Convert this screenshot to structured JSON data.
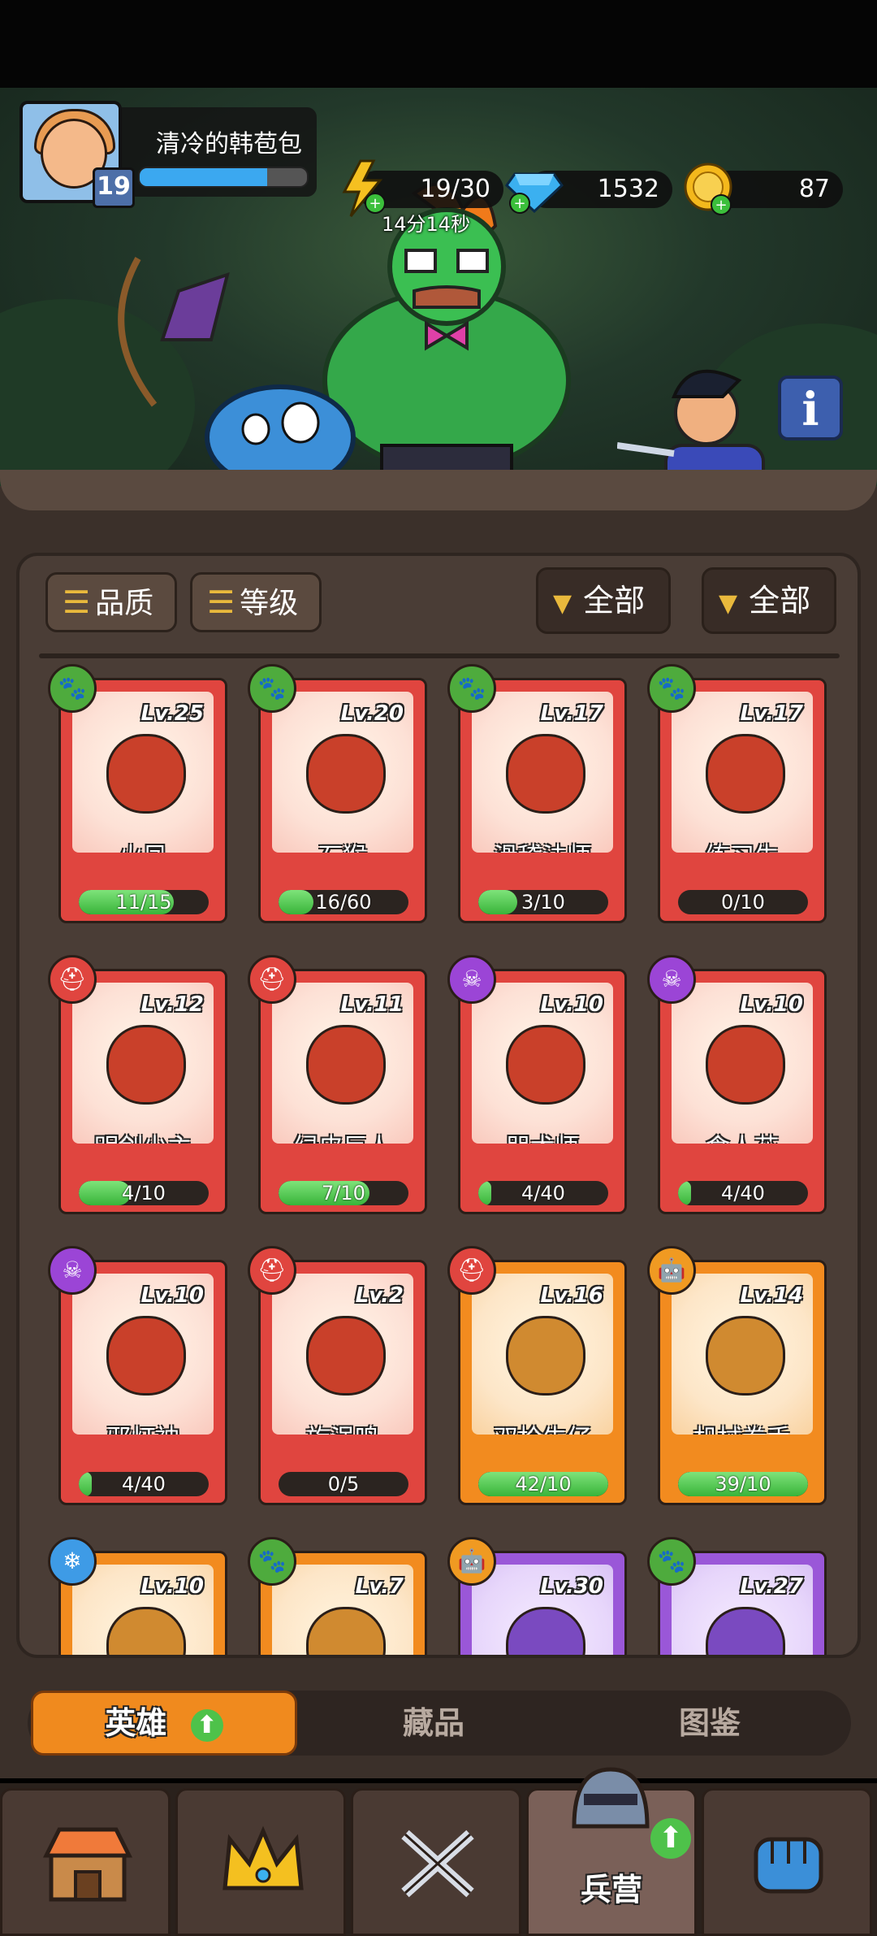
{
  "player": {
    "name": "清冷的韩苞包",
    "level": "19",
    "xp_progress": 0.76
  },
  "resources": {
    "energy": "19/30",
    "energy_timer": "14分14秒",
    "gems": "1532",
    "coins": "87"
  },
  "filters": {
    "sort_quality": "品质",
    "sort_level": "等级",
    "dropdown_1": "全部",
    "dropdown_2": "全部"
  },
  "heroes": [
    {
      "name": "火凤",
      "level": "Lv.25",
      "progress": "11/15",
      "fill": 0.73,
      "rarity": "red",
      "class": "paw"
    },
    {
      "name": "石猴",
      "level": "Lv.20",
      "progress": "16/60",
      "fill": 0.27,
      "rarity": "red",
      "class": "paw"
    },
    {
      "name": "滑稽法师",
      "level": "Lv.17",
      "progress": "3/10",
      "fill": 0.3,
      "rarity": "red",
      "class": "paw"
    },
    {
      "name": "练习生",
      "level": "Lv.17",
      "progress": "0/10",
      "fill": 0,
      "rarity": "red",
      "class": "paw"
    },
    {
      "name": "明剑少主",
      "level": "Lv.12",
      "progress": "4/10",
      "fill": 0.4,
      "rarity": "red",
      "class": "helmet"
    },
    {
      "name": "绿皮巨人",
      "level": "Lv.11",
      "progress": "7/10",
      "fill": 0.7,
      "rarity": "red",
      "class": "helmet"
    },
    {
      "name": "咒术师",
      "level": "Lv.10",
      "progress": "4/40",
      "fill": 0.1,
      "rarity": "red",
      "class": "skull"
    },
    {
      "name": "食人花",
      "level": "Lv.10",
      "progress": "4/40",
      "fill": 0.1,
      "rarity": "red",
      "class": "skull"
    },
    {
      "name": "邪灯神",
      "level": "Lv.10",
      "progress": "4/40",
      "fill": 0.1,
      "rarity": "red",
      "class": "skull"
    },
    {
      "name": "旋涡鸣",
      "level": "Lv.2",
      "progress": "0/5",
      "fill": 0,
      "rarity": "red",
      "class": "helmet"
    },
    {
      "name": "双枪牛仔",
      "level": "Lv.16",
      "progress": "42/10",
      "fill": 1,
      "rarity": "orange",
      "class": "helmet"
    },
    {
      "name": "机械拳手",
      "level": "Lv.14",
      "progress": "39/10",
      "fill": 1,
      "rarity": "orange",
      "class": "robot"
    },
    {
      "name": "",
      "level": "Lv.10",
      "progress": "",
      "fill": 0,
      "rarity": "orange",
      "class": "ice"
    },
    {
      "name": "",
      "level": "Lv.7",
      "progress": "",
      "fill": 0,
      "rarity": "orange",
      "class": "paw"
    },
    {
      "name": "",
      "level": "Lv.30",
      "progress": "",
      "fill": 0,
      "rarity": "purple",
      "class": "robot"
    },
    {
      "name": "",
      "level": "Lv.27",
      "progress": "",
      "fill": 0,
      "rarity": "purple",
      "class": "paw"
    }
  ],
  "subtabs": {
    "heroes": "英雄",
    "collection": "藏品",
    "codex": "图鉴"
  },
  "nav": {
    "barracks": "兵营"
  },
  "colors": {
    "red_card": "#e0453f",
    "orange_card": "#f28b1f",
    "purple_card": "#9a57d8",
    "accent": "#f08a1e",
    "progress": "#39b43a"
  }
}
